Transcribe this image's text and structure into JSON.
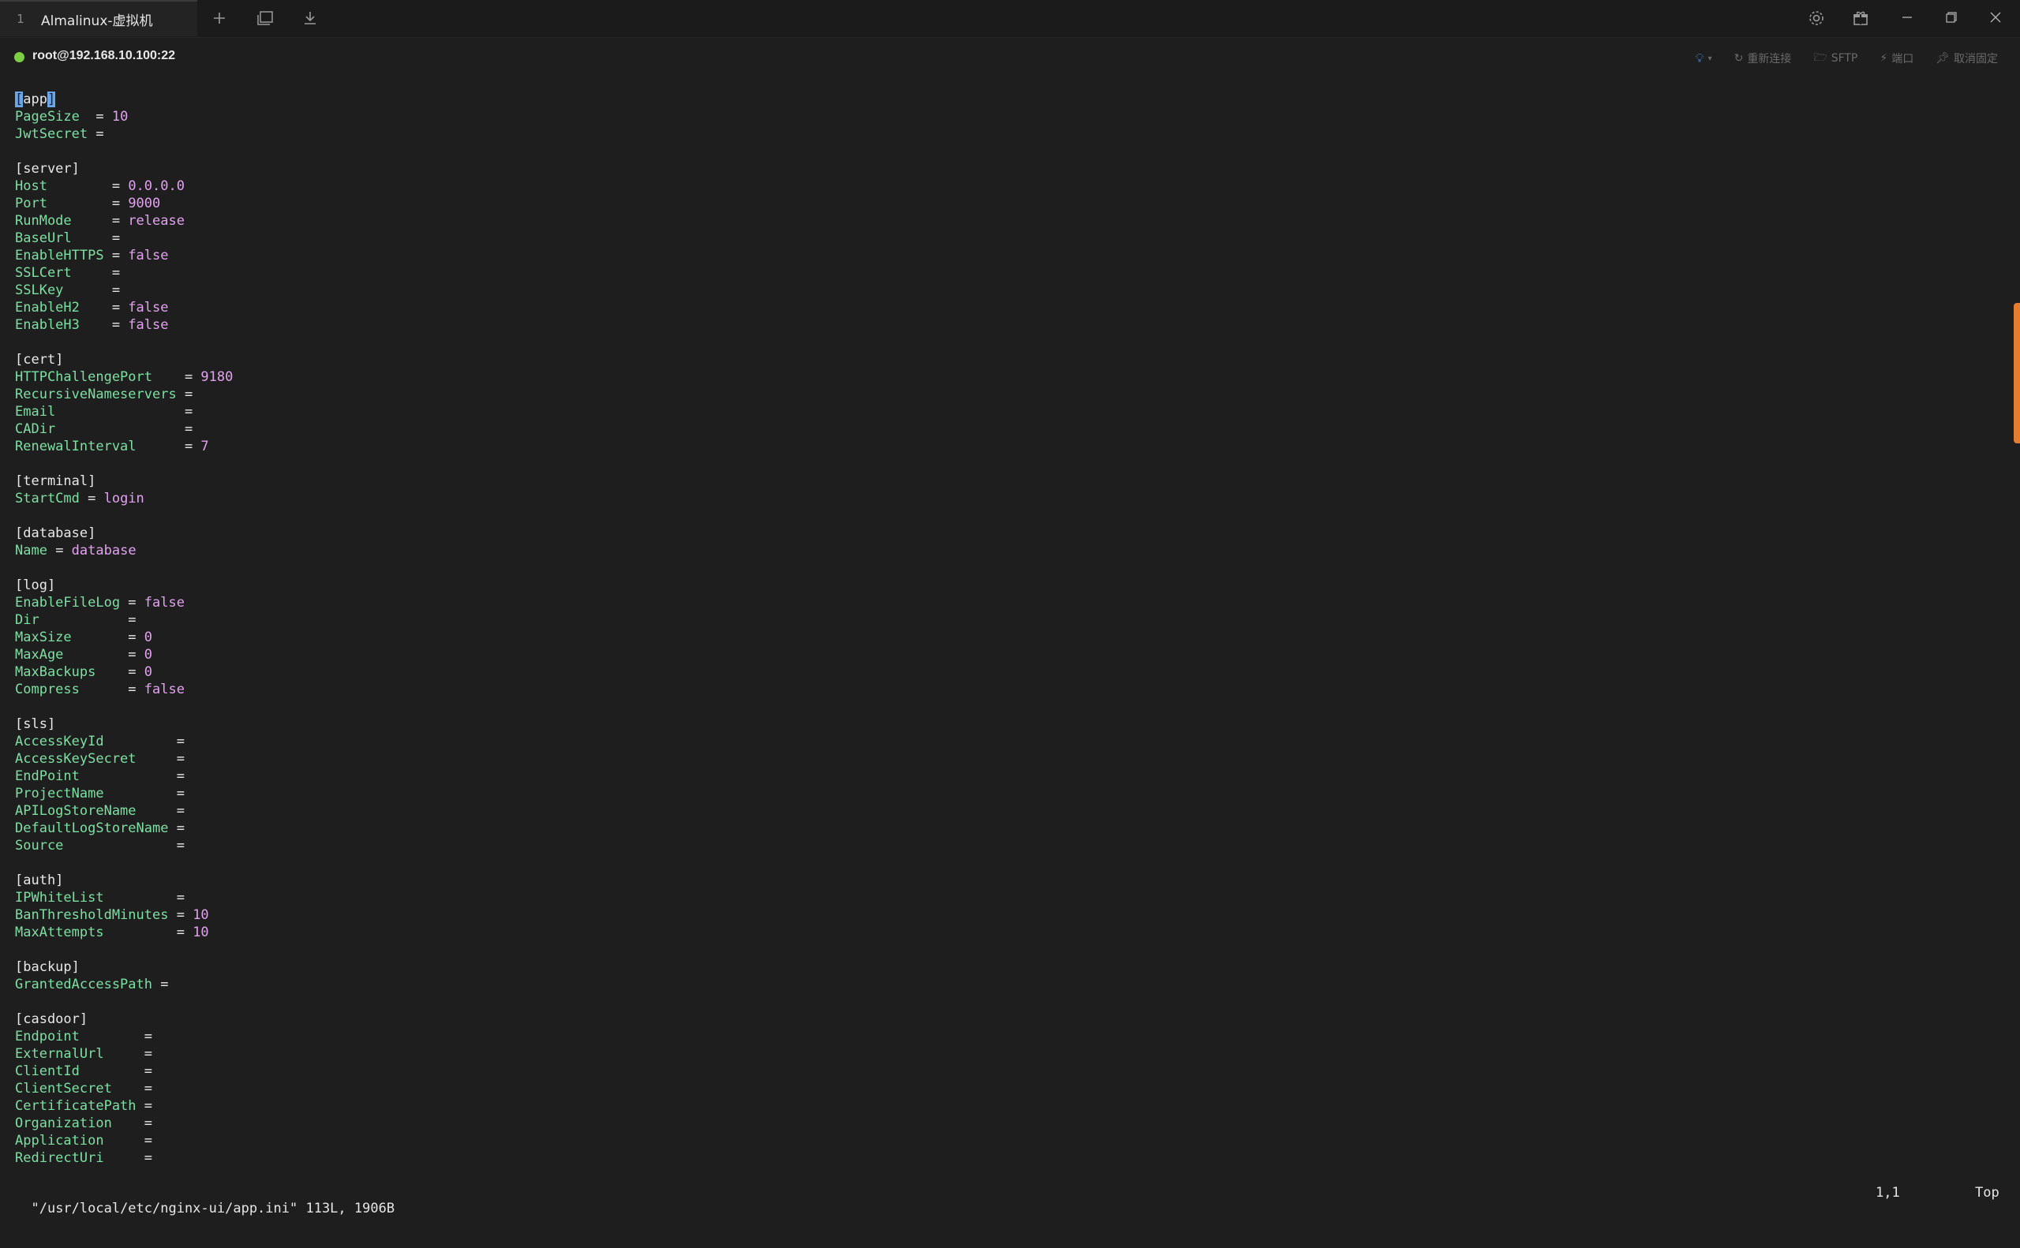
{
  "tab": {
    "index": "1",
    "title": "Almalinux-虚拟机"
  },
  "connection": {
    "host": "root@192.168.10.100:22",
    "status_color": "#7ccf45",
    "actions": [
      "重新连接",
      "SFTP",
      "端口",
      "取消固定"
    ]
  },
  "icons": [
    "plus-icon",
    "clone-window-icon",
    "download-icon",
    "gear-icon",
    "gift-icon",
    "minimize-icon",
    "restore-icon",
    "close-icon",
    "lightbulb-icon",
    "refresh-icon",
    "folder-icon",
    "plug-icon",
    "pin-icon"
  ],
  "file_lines": [
    {
      "type": "section",
      "text": "[app]"
    },
    {
      "type": "kv",
      "key": "PageSize",
      "pad": "  ",
      "value": "10"
    },
    {
      "type": "kv",
      "key": "JwtSecret",
      "pad": " ",
      "value": ""
    },
    {
      "type": "blank"
    },
    {
      "type": "section",
      "text": "[server]"
    },
    {
      "type": "kv",
      "key": "Host",
      "pad": "        ",
      "value": "0.0.0.0"
    },
    {
      "type": "kv",
      "key": "Port",
      "pad": "        ",
      "value": "9000"
    },
    {
      "type": "kv",
      "key": "RunMode",
      "pad": "     ",
      "value": "release"
    },
    {
      "type": "kv",
      "key": "BaseUrl",
      "pad": "     ",
      "value": ""
    },
    {
      "type": "kv",
      "key": "EnableHTTPS",
      "pad": " ",
      "value": "false"
    },
    {
      "type": "kv",
      "key": "SSLCert",
      "pad": "     ",
      "value": ""
    },
    {
      "type": "kv",
      "key": "SSLKey",
      "pad": "      ",
      "value": ""
    },
    {
      "type": "kv",
      "key": "EnableH2",
      "pad": "    ",
      "value": "false"
    },
    {
      "type": "kv",
      "key": "EnableH3",
      "pad": "    ",
      "value": "false"
    },
    {
      "type": "blank"
    },
    {
      "type": "section",
      "text": "[cert]"
    },
    {
      "type": "kv",
      "key": "HTTPChallengePort",
      "pad": "    ",
      "value": "9180"
    },
    {
      "type": "kv",
      "key": "RecursiveNameservers",
      "pad": " ",
      "value": ""
    },
    {
      "type": "kv",
      "key": "Email",
      "pad": "                ",
      "value": ""
    },
    {
      "type": "kv",
      "key": "CADir",
      "pad": "                ",
      "value": ""
    },
    {
      "type": "kv",
      "key": "RenewalInterval",
      "pad": "      ",
      "value": "7"
    },
    {
      "type": "blank"
    },
    {
      "type": "section",
      "text": "[terminal]"
    },
    {
      "type": "kv",
      "key": "StartCmd",
      "pad": " ",
      "value": "login"
    },
    {
      "type": "blank"
    },
    {
      "type": "section",
      "text": "[database]"
    },
    {
      "type": "kv",
      "key": "Name",
      "pad": " ",
      "value": "database"
    },
    {
      "type": "blank"
    },
    {
      "type": "section",
      "text": "[log]"
    },
    {
      "type": "kv",
      "key": "EnableFileLog",
      "pad": " ",
      "value": "false"
    },
    {
      "type": "kv",
      "key": "Dir",
      "pad": "           ",
      "value": ""
    },
    {
      "type": "kv",
      "key": "MaxSize",
      "pad": "       ",
      "value": "0"
    },
    {
      "type": "kv",
      "key": "MaxAge",
      "pad": "        ",
      "value": "0"
    },
    {
      "type": "kv",
      "key": "MaxBackups",
      "pad": "    ",
      "value": "0"
    },
    {
      "type": "kv",
      "key": "Compress",
      "pad": "      ",
      "value": "false"
    },
    {
      "type": "blank"
    },
    {
      "type": "section",
      "text": "[sls]"
    },
    {
      "type": "kv",
      "key": "AccessKeyId",
      "pad": "         ",
      "value": ""
    },
    {
      "type": "kv",
      "key": "AccessKeySecret",
      "pad": "     ",
      "value": ""
    },
    {
      "type": "kv",
      "key": "EndPoint",
      "pad": "            ",
      "value": ""
    },
    {
      "type": "kv",
      "key": "ProjectName",
      "pad": "         ",
      "value": ""
    },
    {
      "type": "kv",
      "key": "APILogStoreName",
      "pad": "     ",
      "value": ""
    },
    {
      "type": "kv",
      "key": "DefaultLogStoreName",
      "pad": " ",
      "value": ""
    },
    {
      "type": "kv",
      "key": "Source",
      "pad": "              ",
      "value": ""
    },
    {
      "type": "blank"
    },
    {
      "type": "section",
      "text": "[auth]"
    },
    {
      "type": "kv",
      "key": "IPWhiteList",
      "pad": "         ",
      "value": ""
    },
    {
      "type": "kv",
      "key": "BanThresholdMinutes",
      "pad": " ",
      "value": "10"
    },
    {
      "type": "kv",
      "key": "MaxAttempts",
      "pad": "         ",
      "value": "10"
    },
    {
      "type": "blank"
    },
    {
      "type": "section",
      "text": "[backup]"
    },
    {
      "type": "kv",
      "key": "GrantedAccessPath",
      "pad": " ",
      "value": ""
    },
    {
      "type": "blank"
    },
    {
      "type": "section",
      "text": "[casdoor]"
    },
    {
      "type": "kv",
      "key": "Endpoint",
      "pad": "        ",
      "value": ""
    },
    {
      "type": "kv",
      "key": "ExternalUrl",
      "pad": "     ",
      "value": ""
    },
    {
      "type": "kv",
      "key": "ClientId",
      "pad": "        ",
      "value": ""
    },
    {
      "type": "kv",
      "key": "ClientSecret",
      "pad": "    ",
      "value": ""
    },
    {
      "type": "kv",
      "key": "CertificatePath",
      "pad": " ",
      "value": ""
    },
    {
      "type": "kv",
      "key": "Organization",
      "pad": "    ",
      "value": ""
    },
    {
      "type": "kv",
      "key": "Application",
      "pad": "     ",
      "value": ""
    },
    {
      "type": "kv",
      "key": "RedirectUri",
      "pad": "     ",
      "value": ""
    }
  ],
  "status": {
    "file_info": "\"/usr/local/etc/nginx-ui/app.ini\" 113L, 1906B",
    "position": "1,1",
    "scroll": "Top"
  }
}
